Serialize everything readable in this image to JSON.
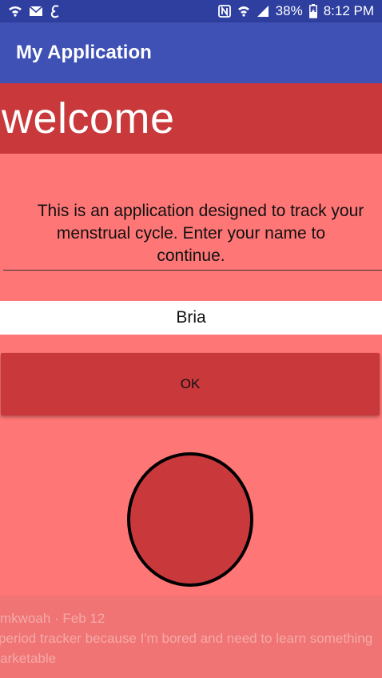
{
  "status_bar": {
    "left_icons": [
      "wifi-call-icon",
      "mail-icon",
      "e-app-icon"
    ],
    "right_icons": [
      "nfc-icon",
      "wifi-icon",
      "signal-icon"
    ],
    "battery_percent": "38%",
    "time": "8:12 PM"
  },
  "app_bar": {
    "title": "My Application"
  },
  "welcome": {
    "text": "welcome"
  },
  "description": {
    "line1": "This is an application designed to track your",
    "line2": "menstrual cycle. Enter your name to",
    "line3": "continue."
  },
  "name_input": {
    "value": "Bria"
  },
  "ok_button": {
    "label": "OK"
  },
  "notification_overlay": {
    "line1": "mkwoah · Feb 12",
    "line2": "period tracker because I'm bored and need to learn something",
    "line3": "marketable"
  },
  "colors": {
    "background": "#ff7676",
    "accent_red": "#c9393c",
    "app_bar": "#3f51b5",
    "status_bar": "#2e3f9f"
  }
}
